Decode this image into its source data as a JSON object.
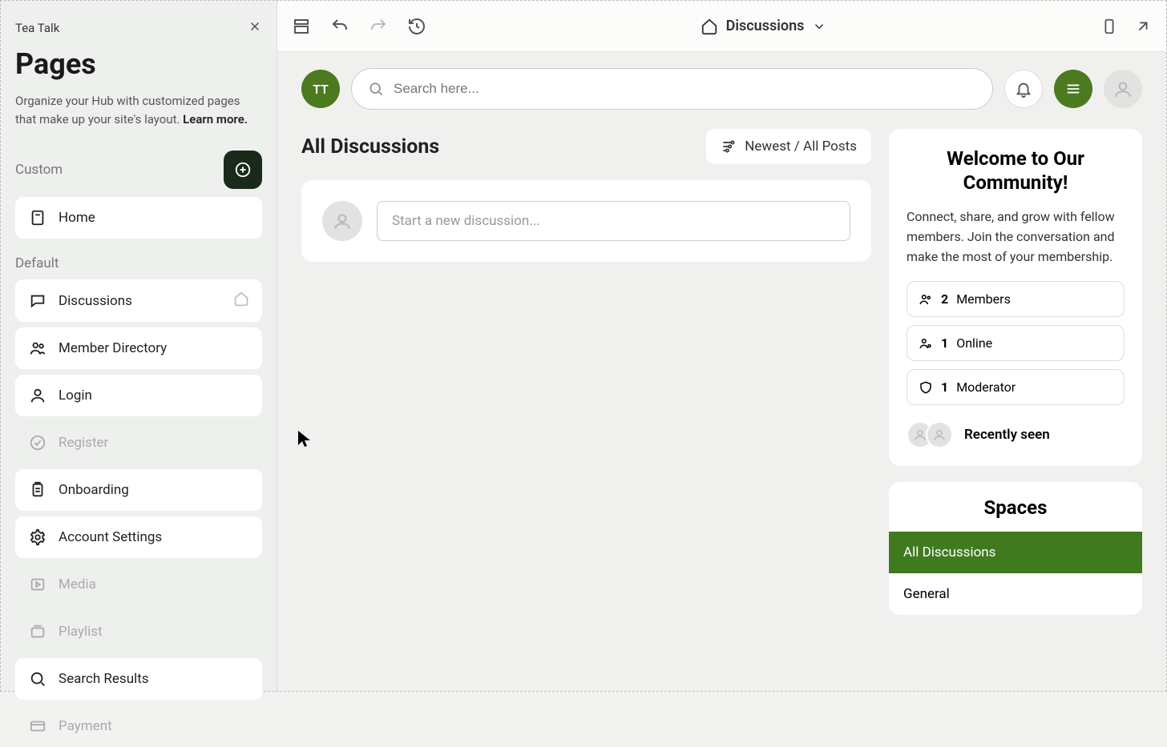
{
  "sidebar": {
    "workspace": "Tea Talk",
    "title": "Pages",
    "description": "Organize your Hub with customized pages that make up your site's layout. ",
    "learnMore": "Learn more.",
    "customLabel": "Custom",
    "defaultLabel": "Default",
    "customItems": [
      {
        "label": "Home",
        "icon": "document-icon"
      }
    ],
    "defaultItems": [
      {
        "label": "Discussions",
        "icon": "chat-icon",
        "disabled": false,
        "isHome": true
      },
      {
        "label": "Member Directory",
        "icon": "users-icon",
        "disabled": false
      },
      {
        "label": "Login",
        "icon": "user-icon",
        "disabled": false
      },
      {
        "label": "Register",
        "icon": "check-circle-icon",
        "disabled": true
      },
      {
        "label": "Onboarding",
        "icon": "clipboard-icon",
        "disabled": false
      },
      {
        "label": "Account Settings",
        "icon": "gear-icon",
        "disabled": false
      },
      {
        "label": "Media",
        "icon": "play-square-icon",
        "disabled": true
      },
      {
        "label": "Playlist",
        "icon": "playlist-icon",
        "disabled": true
      },
      {
        "label": "Search Results",
        "icon": "search-icon",
        "disabled": false
      },
      {
        "label": "Payment",
        "icon": "credit-card-icon",
        "disabled": true
      }
    ]
  },
  "topbar": {
    "currentPage": "Discussions"
  },
  "header": {
    "brandInitials": "TT",
    "searchPlaceholder": "Search here..."
  },
  "discussions": {
    "title": "All Discussions",
    "filterLabel": "Newest / All Posts",
    "composePlaceholder": "Start a new discussion..."
  },
  "welcome": {
    "title": "Welcome to Our Community!",
    "body": "Connect, share, and grow with fellow members. Join the conversation and make the most of your membership.",
    "stats": [
      {
        "count": "2",
        "label": "Members"
      },
      {
        "count": "1",
        "label": "Online"
      },
      {
        "count": "1",
        "label": "Moderator"
      }
    ],
    "recentlyLabel": "Recently seen"
  },
  "spaces": {
    "title": "Spaces",
    "items": [
      {
        "label": "All Discussions",
        "active": true
      },
      {
        "label": "General",
        "active": false
      }
    ]
  }
}
